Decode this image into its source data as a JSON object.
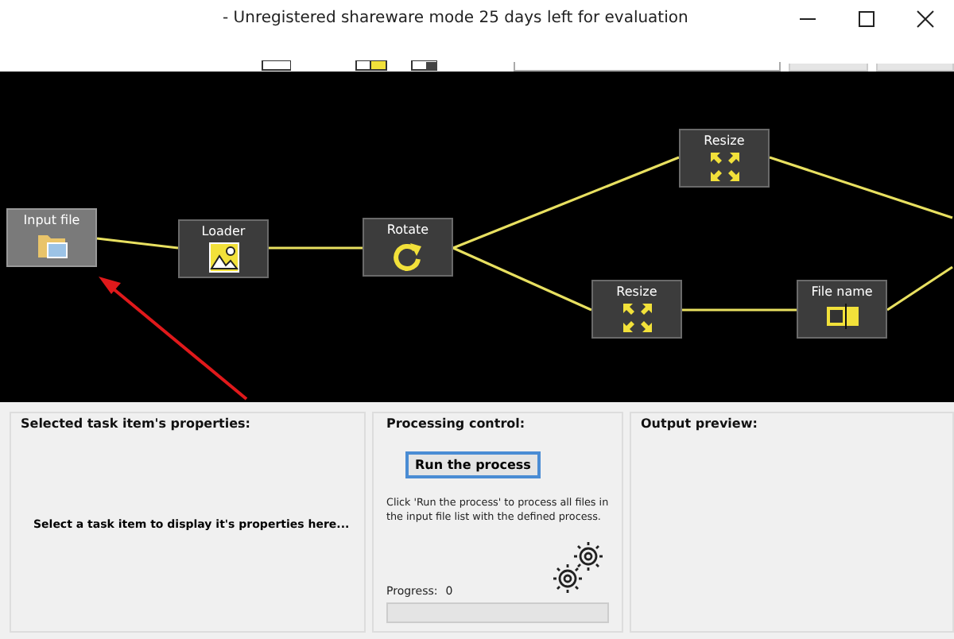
{
  "window": {
    "title": "- Unregistered shareware mode 25 days left for evaluation"
  },
  "canvas": {
    "nodes": [
      {
        "label": "Input file",
        "kind": "input",
        "selected": true
      },
      {
        "label": "Loader",
        "kind": "loader",
        "selected": false
      },
      {
        "label": "Rotate",
        "kind": "rotate",
        "selected": false
      },
      {
        "label": "Resize",
        "kind": "resize",
        "selected": false
      },
      {
        "label": "Resize",
        "kind": "resize",
        "selected": false
      },
      {
        "label": "File name",
        "kind": "filename",
        "selected": false
      }
    ]
  },
  "properties_panel": {
    "title": "Selected task item's properties:",
    "message": "Select a task item to display it's properties here..."
  },
  "processing_panel": {
    "title": "Processing control:",
    "button": "Run the process",
    "description": "Click 'Run the process' to process all files in the input file list with the defined process.",
    "progress_label": "Progress:",
    "progress_value": "0",
    "level": 0
  },
  "output_panel": {
    "title": "Output preview:"
  }
}
